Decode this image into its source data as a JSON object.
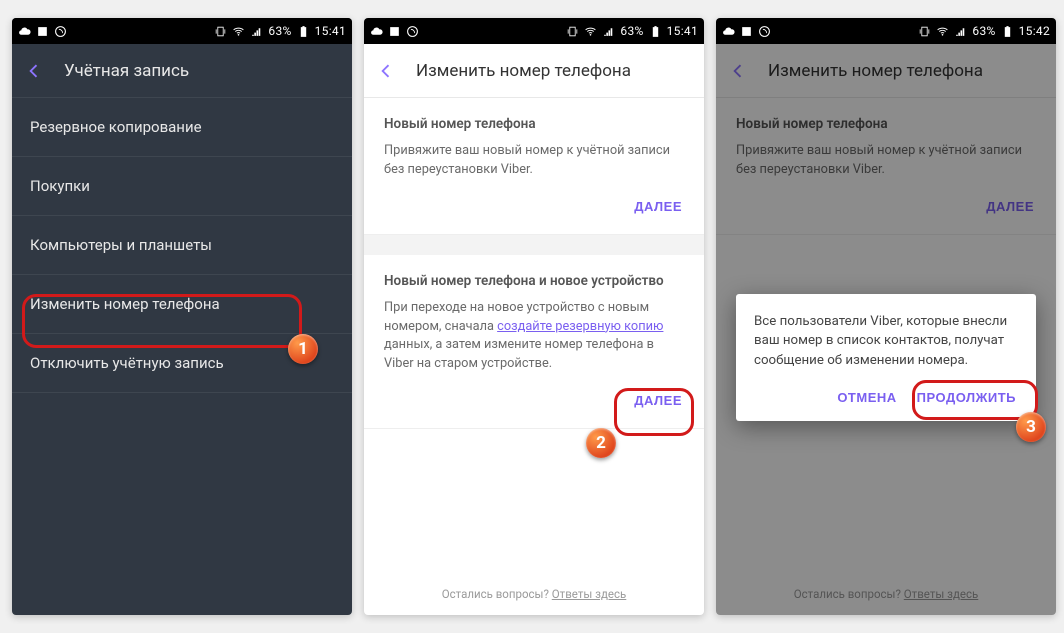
{
  "status": {
    "time1": "15:41",
    "time2": "15:41",
    "time3": "15:42",
    "battery": "63%"
  },
  "screen1": {
    "header": "Учётная запись",
    "items": [
      "Резервное копирование",
      "Покупки",
      "Компьютеры и планшеты",
      "Изменить номер телефона",
      "Отключить учётную запись"
    ]
  },
  "screen2": {
    "header": "Изменить номер телефона",
    "card1_title": "Новый номер телефона",
    "card1_body": "Привяжите ваш новый номер к учётной записи без переустановки Viber.",
    "card2_title": "Новый номер телефона и новое устройство",
    "card2_body_a": "При переходе на новое устройство с новым номером, сначала ",
    "card2_link": "создайте резервную копию",
    "card2_body_b": " данных, а затем измените номер телефона в Viber на старом устройстве.",
    "next": "ДАЛЕЕ",
    "footer_q": "Остались вопросы? ",
    "footer_link": "Ответы здесь"
  },
  "screen3": {
    "header": "Изменить номер телефона",
    "dialog_body": "Все пользователи Viber, которые внесли ваш номер в список контактов, получат сообщение об изменении номера.",
    "cancel": "ОТМЕНА",
    "cont": "ПРОДОЛЖИТЬ"
  },
  "badges": {
    "b1": "1",
    "b2": "2",
    "b3": "3"
  }
}
